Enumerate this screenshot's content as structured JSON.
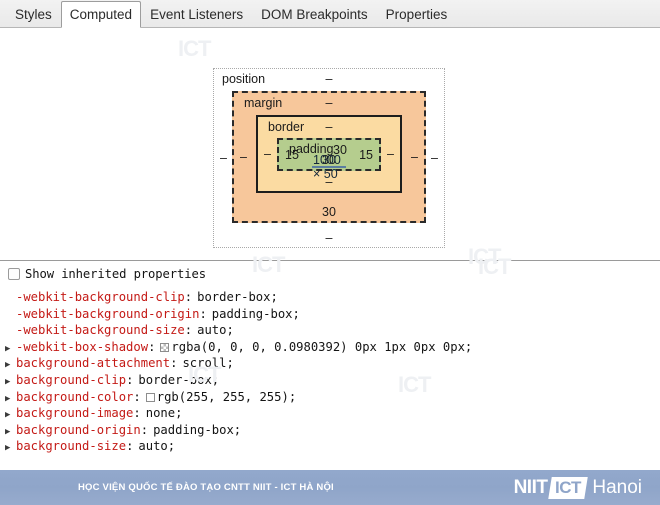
{
  "tabs": [
    {
      "label": "Styles",
      "selected": false
    },
    {
      "label": "Computed",
      "selected": true
    },
    {
      "label": "Event Listeners",
      "selected": false
    },
    {
      "label": "DOM Breakpoints",
      "selected": false
    },
    {
      "label": "Properties",
      "selected": false
    }
  ],
  "box_model": {
    "position": {
      "label": "position",
      "top": "–",
      "right": "–",
      "bottom": "–",
      "left": "–",
      "color": "#ffffff"
    },
    "margin": {
      "label": "margin",
      "top": "–",
      "right": "–",
      "bottom": "30",
      "left": "–",
      "color": "#f7c79b"
    },
    "border": {
      "label": "border",
      "top": "–",
      "right": "–",
      "bottom": "–",
      "left": "–",
      "color": "#fbdba2"
    },
    "padding": {
      "label": "padding",
      "top": "30",
      "right": "15",
      "bottom": "30",
      "left": "15",
      "color": "#b5cd8e"
    },
    "content": {
      "dimensions": "1000 × 50",
      "color": "#83b3d8"
    }
  },
  "inherited": {
    "checkbox_label": "Show inherited properties",
    "checked": false
  },
  "properties": [
    {
      "expandable": false,
      "name": "-webkit-background-clip",
      "value": "border-box;",
      "swatch": null
    },
    {
      "expandable": false,
      "name": "-webkit-background-origin",
      "value": "padding-box;",
      "swatch": null
    },
    {
      "expandable": false,
      "name": "-webkit-background-size",
      "value": "auto;",
      "swatch": null
    },
    {
      "expandable": true,
      "name": "-webkit-box-shadow",
      "value": "rgba(0, 0, 0, 0.0980392) 0px 1px 0px 0px;",
      "swatch": "checker"
    },
    {
      "expandable": true,
      "name": "background-attachment",
      "value": "scroll;",
      "swatch": null
    },
    {
      "expandable": true,
      "name": "background-clip",
      "value": "border-box;",
      "swatch": null
    },
    {
      "expandable": true,
      "name": "background-color",
      "value": "rgb(255, 255, 255);",
      "swatch": "#ffffff"
    },
    {
      "expandable": true,
      "name": "background-image",
      "value": "none;",
      "swatch": null
    },
    {
      "expandable": true,
      "name": "background-origin",
      "value": "padding-box;",
      "swatch": null
    },
    {
      "expandable": true,
      "name": "background-size",
      "value": "auto;",
      "swatch": null
    }
  ],
  "watermarks": [
    "ICT",
    "ICT",
    "ICT",
    "ICT",
    "ICT"
  ],
  "footer": {
    "text": "HỌC VIỆN QUỐC TẾ ĐÀO TẠO CNTT NIIT - ICT HÀ NỘI",
    "logo_primary": "NIIT",
    "logo_badge": "ICT",
    "logo_suffix": "Hanoi",
    "background_color": "#8fa5c9"
  }
}
